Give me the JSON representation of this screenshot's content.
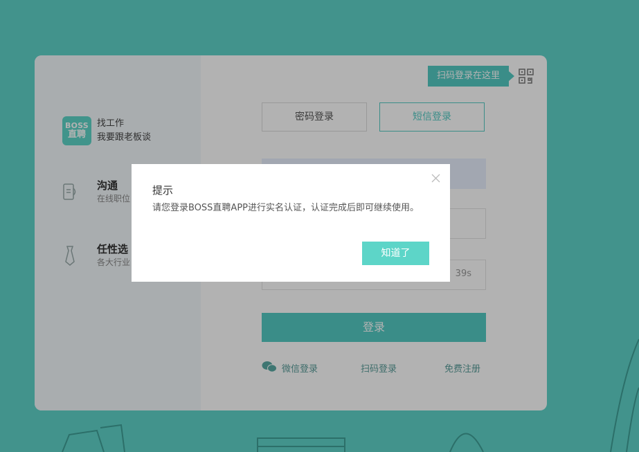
{
  "colors": {
    "page_background": "#5fd3c9",
    "accent": "#53cac3",
    "overlay": "rgba(0,0,0,0.3)"
  },
  "brand": {
    "logo_line1": "BOSS",
    "logo_line2": "直聘",
    "slogan_line1": "找工作",
    "slogan_line2": "我要跟老板谈"
  },
  "features": [
    {
      "icon": "chat-phone-icon",
      "title": "沟通",
      "desc": "在线职位"
    },
    {
      "icon": "tie-icon",
      "title": "任性选",
      "desc": "各大行业"
    }
  ],
  "qr_tip": {
    "label": "扫码登录在这里",
    "icon": "qr-code-icon"
  },
  "tabs": {
    "password": "密码登录",
    "sms": "短信登录",
    "active": "sms"
  },
  "sms_field": {
    "countdown": "39s"
  },
  "login_button": "登录",
  "bottom_links": {
    "wechat": "微信登录",
    "qr": "扫码登录",
    "register": "免费注册"
  },
  "dialog": {
    "title": "提示",
    "message": "请您登录BOSS直聘APP进行实名认证，认证完成后即可继续使用。",
    "ok_button": "知道了"
  }
}
